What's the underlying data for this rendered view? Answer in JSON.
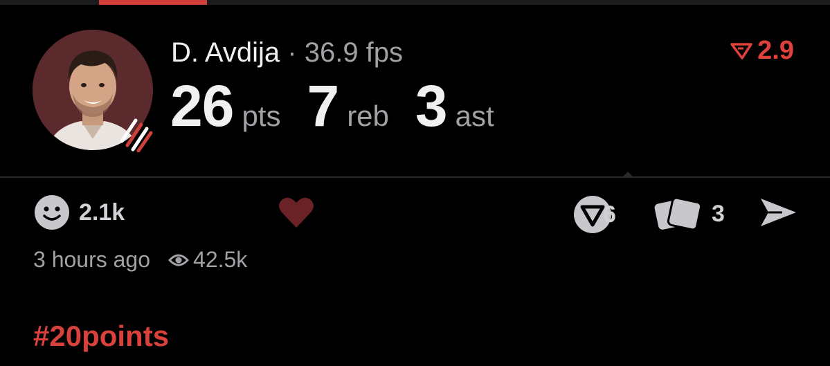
{
  "colors": {
    "accent": "#e0413a",
    "heart": "#6b2226",
    "muted": "#a1a1a6",
    "background": "#000000"
  },
  "player": {
    "name": "D. Avdija",
    "separator": "·",
    "fps": "36.9 fps"
  },
  "score_badge": {
    "icon": "triangle-flag-icon",
    "value": "2.9"
  },
  "stats": [
    {
      "value": "26",
      "unit": "pts"
    },
    {
      "value": "7",
      "unit": "reb"
    },
    {
      "value": "3",
      "unit": "ast"
    }
  ],
  "actions": {
    "reactions": {
      "icon": "smiley-icon",
      "count": "2.1k"
    },
    "like": {
      "icon": "heart-icon"
    },
    "votes": {
      "icon": "circle-v-icon",
      "count": "6"
    },
    "cards": {
      "icon": "cards-icon",
      "count": "3"
    },
    "share": {
      "icon": "send-icon"
    }
  },
  "meta": {
    "time": "3 hours ago",
    "views_icon": "eye-icon",
    "views": "42.5k"
  },
  "hashtag": "#20points"
}
